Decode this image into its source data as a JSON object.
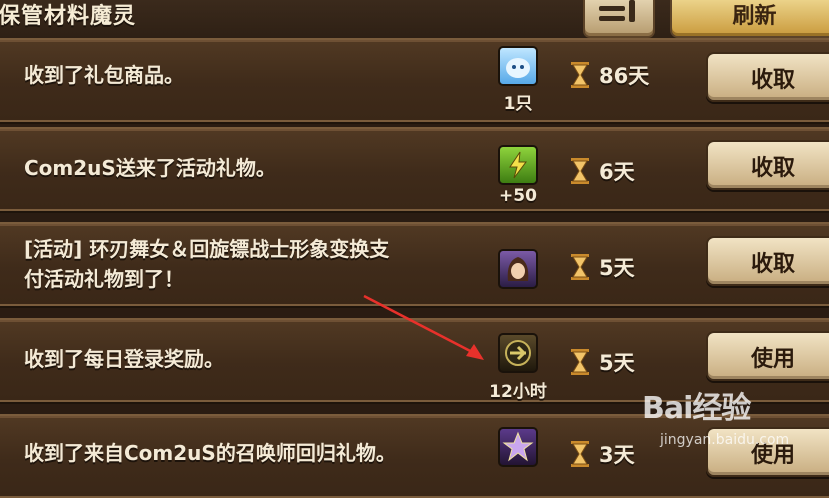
{
  "header": {
    "title": "保管材料魔灵",
    "refresh_label": "刷新"
  },
  "rows": [
    {
      "message": "收到了礼包商品。",
      "quantity": "1只",
      "days": "86天",
      "button": "收取",
      "icon": "water-spirit-icon"
    },
    {
      "message": "Com2uS送来了活动礼物。",
      "quantity": "+50",
      "days": "6天",
      "button": "收取",
      "icon": "energy-bolt-icon"
    },
    {
      "message": "[活动] 环刃舞女＆回旋镖战士形象变换支付活动礼物到了！",
      "message_line1": "[活动] 环刃舞女＆回旋镖战士形象变换支",
      "message_line2": "付活动礼物到了！",
      "quantity": "",
      "days": "5天",
      "button": "收取",
      "icon": "character-portrait-icon"
    },
    {
      "message": "收到了每日登录奖励。",
      "quantity": "12小时",
      "days": "5天",
      "button": "使用",
      "icon": "boost-badge-icon"
    },
    {
      "message": "收到了来自Com2uS的召唤师回归礼物。",
      "quantity": "",
      "days": "3天",
      "button": "使用",
      "icon": "star-emblem-icon"
    }
  ],
  "watermark": {
    "logo": "Bai经验",
    "url": "jingyan.baidu.com"
  },
  "colors": {
    "row_bg": "#4a3320",
    "text": "#f4ead6",
    "button": "#e6d3ac",
    "arrow": "#e8312b"
  }
}
